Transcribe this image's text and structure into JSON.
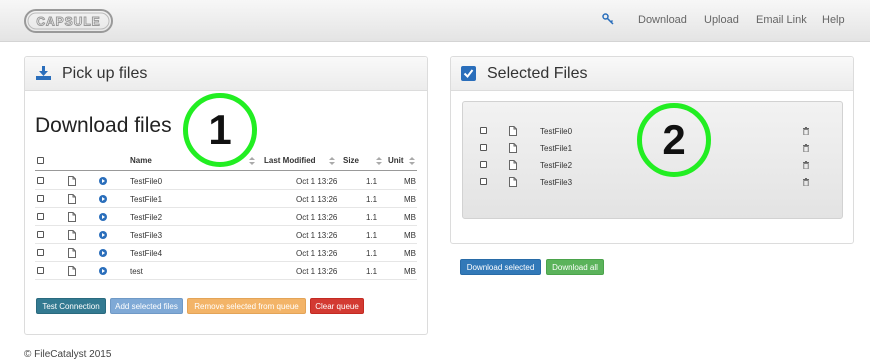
{
  "brand": {
    "logo_text": "CAPSULE"
  },
  "nav": {
    "key_icon": "key-icon",
    "links": [
      "Download",
      "Upload",
      "Email Link",
      "Help"
    ]
  },
  "pickup": {
    "title": "Pick up files",
    "icon": "download-icon",
    "heading": "Download files",
    "columns": {
      "name": "Name",
      "modified": "Last Modified",
      "size": "Size",
      "unit": "Unit"
    },
    "rows": [
      {
        "name": "TestFile0",
        "modified": "Oct 1 13:26",
        "size": "1.1",
        "unit": "MB"
      },
      {
        "name": "TestFile1",
        "modified": "Oct 1 13:26",
        "size": "1.1",
        "unit": "MB"
      },
      {
        "name": "TestFile2",
        "modified": "Oct 1 13:26",
        "size": "1.1",
        "unit": "MB"
      },
      {
        "name": "TestFile3",
        "modified": "Oct 1 13:26",
        "size": "1.1",
        "unit": "MB"
      },
      {
        "name": "TestFile4",
        "modified": "Oct 1 13:26",
        "size": "1.1",
        "unit": "MB"
      },
      {
        "name": "test",
        "modified": "Oct 1 13:26",
        "size": "1.1",
        "unit": "MB"
      }
    ],
    "buttons": {
      "test": "Test Connection",
      "add": "Add selected files",
      "remove": "Remove selected from queue",
      "clear": "Clear queue"
    },
    "annotation": "1"
  },
  "selected": {
    "title": "Selected Files",
    "icon": "checkbox-checked-icon",
    "files": [
      "TestFile0",
      "TestFile1",
      "TestFile2",
      "TestFile3"
    ],
    "annotation": "2",
    "buttons": {
      "download_selected": "Download selected",
      "download_all": "Download all"
    }
  },
  "colors": {
    "btn_test": "#337a91",
    "btn_add": "#7fa9d6",
    "btn_remove": "#f3b468",
    "btn_clear": "#d33a32",
    "btn_download_selected": "#3279b8",
    "btn_download_all": "#5bb35b",
    "annotation_ring": "#22ee22"
  },
  "footer": {
    "text": "© FileCatalyst 2015"
  }
}
